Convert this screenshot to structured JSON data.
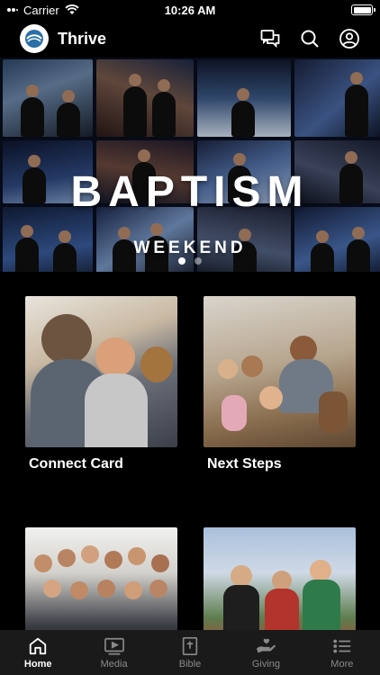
{
  "status_bar": {
    "carrier": "Carrier",
    "time": "10:26 AM"
  },
  "header": {
    "app_title": "Thrive",
    "icons": [
      "chat-icon",
      "search-icon",
      "profile-icon"
    ]
  },
  "banner": {
    "title": "BAPTISM",
    "subtitle": "WEEKEND",
    "active_slide": 1,
    "slide_count": 2
  },
  "cards": [
    {
      "label": "Connect Card"
    },
    {
      "label": "Next Steps"
    },
    {
      "label": ""
    },
    {
      "label": ""
    }
  ],
  "tabs": [
    {
      "label": "Home",
      "icon": "home-icon",
      "active": true
    },
    {
      "label": "Media",
      "icon": "media-icon",
      "active": false
    },
    {
      "label": "Bible",
      "icon": "bible-icon",
      "active": false
    },
    {
      "label": "Giving",
      "icon": "giving-icon",
      "active": false
    },
    {
      "label": "More",
      "icon": "more-icon",
      "active": false
    }
  ],
  "colors": {
    "background": "#000000",
    "tab_bar": "#1a1a1a",
    "inactive_tab": "#8a8a8a",
    "active_tab": "#ffffff"
  }
}
